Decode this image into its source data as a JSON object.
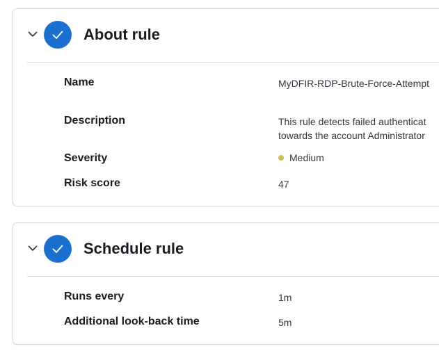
{
  "about": {
    "title": "About rule",
    "fields": {
      "name": {
        "label": "Name",
        "value": "MyDFIR-RDP-Brute-Force-Attempt"
      },
      "description": {
        "label": "Description",
        "line1": "This rule detects failed authenticat",
        "line2": "towards the account Administrator"
      },
      "severity": {
        "label": "Severity",
        "value": "Medium"
      },
      "risk_score": {
        "label": "Risk score",
        "value": "47"
      }
    }
  },
  "schedule": {
    "title": "Schedule rule",
    "fields": {
      "runs_every": {
        "label": "Runs every",
        "value": "1m"
      },
      "lookback": {
        "label": "Additional look-back time",
        "value": "5m"
      }
    }
  },
  "colors": {
    "step_complete": "#1a6fcf",
    "severity_medium": "#d6bf57",
    "border": "#d3dae6"
  },
  "icons": {
    "collapse": "chevron-down-icon",
    "step_complete": "check-icon"
  }
}
